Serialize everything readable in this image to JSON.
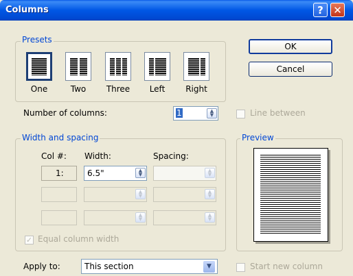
{
  "window": {
    "title": "Columns",
    "help": "?",
    "close": "✕"
  },
  "presets": {
    "legend": "Presets",
    "items": [
      {
        "label": "One",
        "selected": true
      },
      {
        "label": "Two",
        "selected": false
      },
      {
        "label": "Three",
        "selected": false
      },
      {
        "label": "Left",
        "selected": false
      },
      {
        "label": "Right",
        "selected": false
      }
    ]
  },
  "buttons": {
    "ok": "OK",
    "cancel": "Cancel"
  },
  "number_of_columns": {
    "label": "Number of columns:",
    "value": "1"
  },
  "line_between": {
    "label": "Line between",
    "checked": false
  },
  "width_spacing": {
    "legend": "Width and spacing",
    "col_header": "Col #:",
    "width_header": "Width:",
    "spacing_header": "Spacing:",
    "rows": [
      {
        "col": "1:",
        "width": "6.5\"",
        "spacing": ""
      },
      {
        "col": "",
        "width": "",
        "spacing": ""
      },
      {
        "col": "",
        "width": "",
        "spacing": ""
      }
    ]
  },
  "equal_column_width": {
    "label": "Equal column width",
    "checked": true
  },
  "preview": {
    "legend": "Preview"
  },
  "apply_to": {
    "label": "Apply to:",
    "value": "This section"
  },
  "start_new_column": {
    "label": "Start new column",
    "checked": false
  },
  "colors": {
    "titlebar": "#0054e3",
    "dialog_bg": "#ece9d8",
    "group_label": "#0046d5",
    "disabled_text": "#aca899"
  },
  "icons": [
    "help-icon",
    "close-icon",
    "spin-up-icon",
    "spin-down-icon",
    "dropdown-arrow-icon",
    "checkmark-icon"
  ]
}
